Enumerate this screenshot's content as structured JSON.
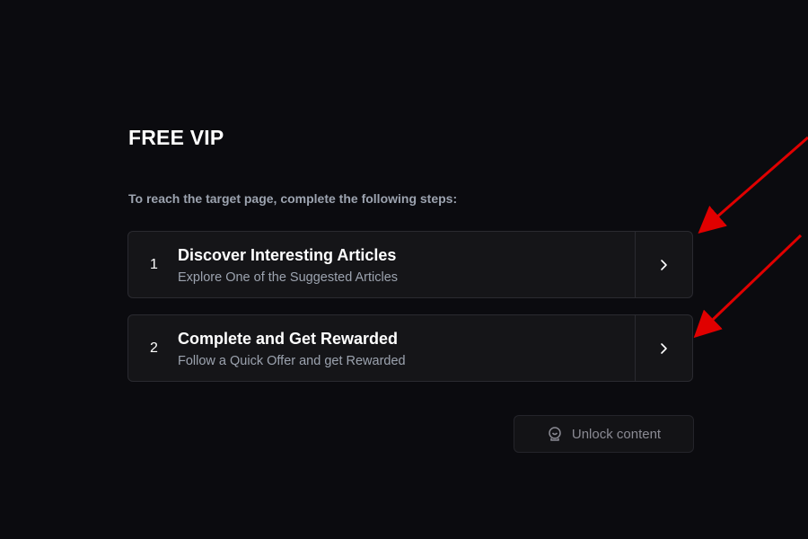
{
  "header": {
    "title": "FREE VIP",
    "instructions": "To reach the target page, complete the following steps:"
  },
  "steps": [
    {
      "number": "1",
      "title": "Discover Interesting Articles",
      "subtitle": "Explore One of the Suggested Articles",
      "icon": "chevron-right-icon"
    },
    {
      "number": "2",
      "title": "Complete and Get Rewarded",
      "subtitle": "Follow a Quick Offer and get Rewarded",
      "icon": "chevron-right-icon"
    }
  ],
  "unlock_button": {
    "label": "Unlock content",
    "icon": "unlock-icon",
    "enabled": false
  },
  "colors": {
    "background": "#0b0b0f",
    "card": "#151518",
    "card_border": "#2a2a30",
    "muted_text": "#9ca3af",
    "annotation_arrow": "#e00000"
  }
}
